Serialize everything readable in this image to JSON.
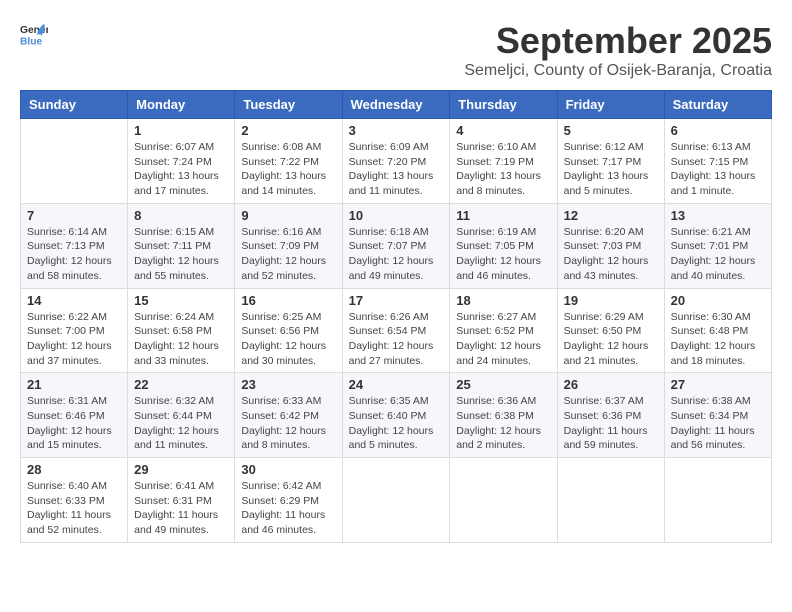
{
  "logo": {
    "general": "General",
    "blue": "Blue"
  },
  "title": "September 2025",
  "location": "Semeljci, County of Osijek-Baranja, Croatia",
  "weekdays": [
    "Sunday",
    "Monday",
    "Tuesday",
    "Wednesday",
    "Thursday",
    "Friday",
    "Saturday"
  ],
  "weeks": [
    [
      {
        "day": "",
        "info": ""
      },
      {
        "day": "1",
        "info": "Sunrise: 6:07 AM\nSunset: 7:24 PM\nDaylight: 13 hours\nand 17 minutes."
      },
      {
        "day": "2",
        "info": "Sunrise: 6:08 AM\nSunset: 7:22 PM\nDaylight: 13 hours\nand 14 minutes."
      },
      {
        "day": "3",
        "info": "Sunrise: 6:09 AM\nSunset: 7:20 PM\nDaylight: 13 hours\nand 11 minutes."
      },
      {
        "day": "4",
        "info": "Sunrise: 6:10 AM\nSunset: 7:19 PM\nDaylight: 13 hours\nand 8 minutes."
      },
      {
        "day": "5",
        "info": "Sunrise: 6:12 AM\nSunset: 7:17 PM\nDaylight: 13 hours\nand 5 minutes."
      },
      {
        "day": "6",
        "info": "Sunrise: 6:13 AM\nSunset: 7:15 PM\nDaylight: 13 hours\nand 1 minute."
      }
    ],
    [
      {
        "day": "7",
        "info": "Sunrise: 6:14 AM\nSunset: 7:13 PM\nDaylight: 12 hours\nand 58 minutes."
      },
      {
        "day": "8",
        "info": "Sunrise: 6:15 AM\nSunset: 7:11 PM\nDaylight: 12 hours\nand 55 minutes."
      },
      {
        "day": "9",
        "info": "Sunrise: 6:16 AM\nSunset: 7:09 PM\nDaylight: 12 hours\nand 52 minutes."
      },
      {
        "day": "10",
        "info": "Sunrise: 6:18 AM\nSunset: 7:07 PM\nDaylight: 12 hours\nand 49 minutes."
      },
      {
        "day": "11",
        "info": "Sunrise: 6:19 AM\nSunset: 7:05 PM\nDaylight: 12 hours\nand 46 minutes."
      },
      {
        "day": "12",
        "info": "Sunrise: 6:20 AM\nSunset: 7:03 PM\nDaylight: 12 hours\nand 43 minutes."
      },
      {
        "day": "13",
        "info": "Sunrise: 6:21 AM\nSunset: 7:01 PM\nDaylight: 12 hours\nand 40 minutes."
      }
    ],
    [
      {
        "day": "14",
        "info": "Sunrise: 6:22 AM\nSunset: 7:00 PM\nDaylight: 12 hours\nand 37 minutes."
      },
      {
        "day": "15",
        "info": "Sunrise: 6:24 AM\nSunset: 6:58 PM\nDaylight: 12 hours\nand 33 minutes."
      },
      {
        "day": "16",
        "info": "Sunrise: 6:25 AM\nSunset: 6:56 PM\nDaylight: 12 hours\nand 30 minutes."
      },
      {
        "day": "17",
        "info": "Sunrise: 6:26 AM\nSunset: 6:54 PM\nDaylight: 12 hours\nand 27 minutes."
      },
      {
        "day": "18",
        "info": "Sunrise: 6:27 AM\nSunset: 6:52 PM\nDaylight: 12 hours\nand 24 minutes."
      },
      {
        "day": "19",
        "info": "Sunrise: 6:29 AM\nSunset: 6:50 PM\nDaylight: 12 hours\nand 21 minutes."
      },
      {
        "day": "20",
        "info": "Sunrise: 6:30 AM\nSunset: 6:48 PM\nDaylight: 12 hours\nand 18 minutes."
      }
    ],
    [
      {
        "day": "21",
        "info": "Sunrise: 6:31 AM\nSunset: 6:46 PM\nDaylight: 12 hours\nand 15 minutes."
      },
      {
        "day": "22",
        "info": "Sunrise: 6:32 AM\nSunset: 6:44 PM\nDaylight: 12 hours\nand 11 minutes."
      },
      {
        "day": "23",
        "info": "Sunrise: 6:33 AM\nSunset: 6:42 PM\nDaylight: 12 hours\nand 8 minutes."
      },
      {
        "day": "24",
        "info": "Sunrise: 6:35 AM\nSunset: 6:40 PM\nDaylight: 12 hours\nand 5 minutes."
      },
      {
        "day": "25",
        "info": "Sunrise: 6:36 AM\nSunset: 6:38 PM\nDaylight: 12 hours\nand 2 minutes."
      },
      {
        "day": "26",
        "info": "Sunrise: 6:37 AM\nSunset: 6:36 PM\nDaylight: 11 hours\nand 59 minutes."
      },
      {
        "day": "27",
        "info": "Sunrise: 6:38 AM\nSunset: 6:34 PM\nDaylight: 11 hours\nand 56 minutes."
      }
    ],
    [
      {
        "day": "28",
        "info": "Sunrise: 6:40 AM\nSunset: 6:33 PM\nDaylight: 11 hours\nand 52 minutes."
      },
      {
        "day": "29",
        "info": "Sunrise: 6:41 AM\nSunset: 6:31 PM\nDaylight: 11 hours\nand 49 minutes."
      },
      {
        "day": "30",
        "info": "Sunrise: 6:42 AM\nSunset: 6:29 PM\nDaylight: 11 hours\nand 46 minutes."
      },
      {
        "day": "",
        "info": ""
      },
      {
        "day": "",
        "info": ""
      },
      {
        "day": "",
        "info": ""
      },
      {
        "day": "",
        "info": ""
      }
    ]
  ]
}
